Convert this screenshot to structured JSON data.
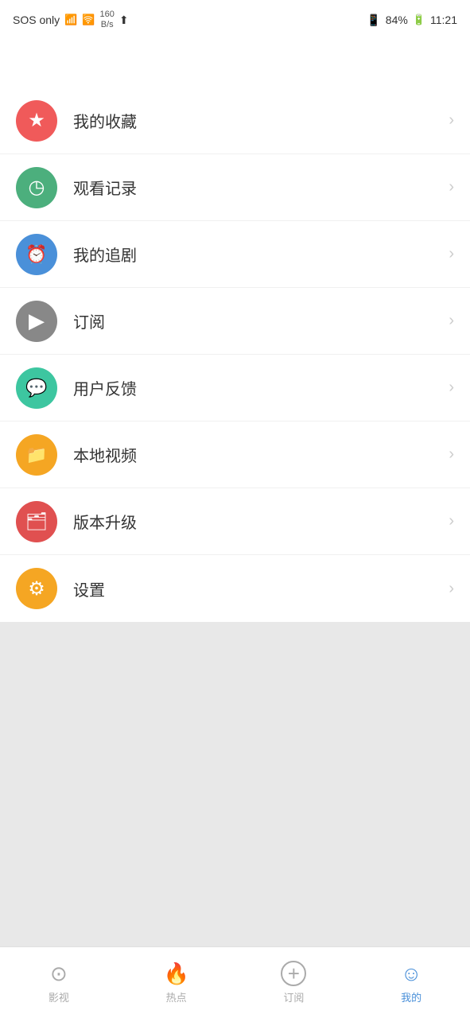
{
  "statusBar": {
    "sosText": "SOS only",
    "speed": "160\nB/s",
    "battery": "84%",
    "time": "11:21"
  },
  "menu": {
    "items": [
      {
        "id": "favorites",
        "label": "我的收藏",
        "iconClass": "icon-red",
        "icon": "★"
      },
      {
        "id": "history",
        "label": "观看记录",
        "iconClass": "icon-green",
        "icon": "◷"
      },
      {
        "id": "following",
        "label": "我的追剧",
        "iconClass": "icon-blue",
        "icon": "⏰"
      },
      {
        "id": "subscribe",
        "label": "订阅",
        "iconClass": "icon-gray",
        "icon": "▶"
      },
      {
        "id": "feedback",
        "label": "用户反馈",
        "iconClass": "icon-teal",
        "icon": "💬"
      },
      {
        "id": "localvideo",
        "label": "本地视频",
        "iconClass": "icon-orange",
        "icon": "📁"
      },
      {
        "id": "update",
        "label": "版本升级",
        "iconClass": "icon-red-layered",
        "icon": "🗂"
      },
      {
        "id": "settings",
        "label": "设置",
        "iconClass": "icon-orange-settings",
        "icon": "⚙"
      }
    ]
  },
  "bottomNav": {
    "items": [
      {
        "id": "movies",
        "label": "影视",
        "icon": "⊙",
        "active": false
      },
      {
        "id": "hotspot",
        "label": "热点",
        "icon": "🔥",
        "active": false
      },
      {
        "id": "subscribe",
        "label": "订阅",
        "icon": "⊕",
        "active": false
      },
      {
        "id": "mine",
        "label": "我的",
        "icon": "☺",
        "active": true
      }
    ]
  }
}
